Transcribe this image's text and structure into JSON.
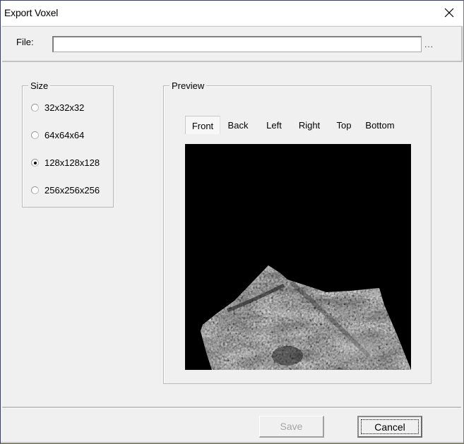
{
  "window": {
    "title": "Export Voxel",
    "close_icon": "close-x-icon"
  },
  "file": {
    "label": "File:",
    "value": "",
    "placeholder": "",
    "browse_label": "..."
  },
  "size": {
    "group_label": "Size",
    "options": [
      {
        "label": "32x32x32",
        "selected": false
      },
      {
        "label": "64x64x64",
        "selected": false
      },
      {
        "label": "128x128x128",
        "selected": true
      },
      {
        "label": "256x256x256",
        "selected": false
      }
    ]
  },
  "preview": {
    "group_label": "Preview",
    "tabs": [
      {
        "label": "Front",
        "active": true
      },
      {
        "label": "Back",
        "active": false
      },
      {
        "label": "Left",
        "active": false
      },
      {
        "label": "Right",
        "active": false
      },
      {
        "label": "Top",
        "active": false
      },
      {
        "label": "Bottom",
        "active": false
      }
    ],
    "image_description": "grayscale voxel terrain front view on black background"
  },
  "buttons": {
    "save_label": "Save",
    "save_enabled": false,
    "cancel_label": "Cancel"
  }
}
